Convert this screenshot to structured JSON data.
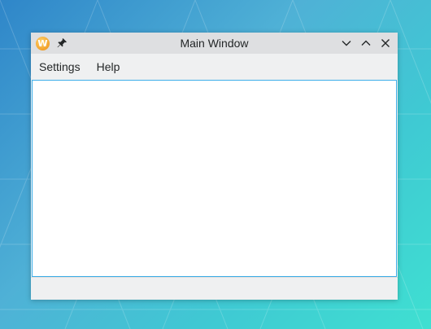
{
  "window": {
    "title": "Main Window",
    "app_icon_letter": "W"
  },
  "menubar": {
    "items": [
      {
        "label": "Settings"
      },
      {
        "label": "Help"
      }
    ]
  },
  "icons": {
    "app": "app-w-logo-icon",
    "pin": "pin-icon",
    "minimize": "chevron-down-icon",
    "maximize": "chevron-up-icon",
    "close": "close-icon"
  },
  "colors": {
    "titlebar_bg": "#dedfe1",
    "window_bg": "#eff0f1",
    "focus_border": "#3daee9",
    "text": "#232627"
  }
}
